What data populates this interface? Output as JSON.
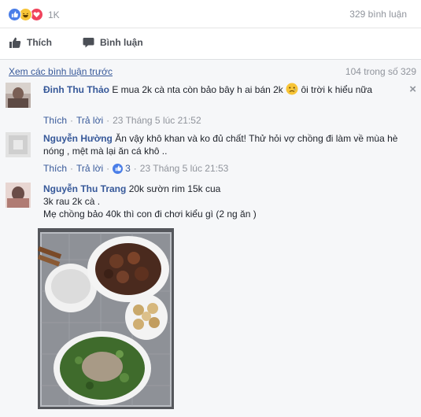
{
  "reactions": {
    "count": "1K",
    "types": [
      "like-icon",
      "haha-icon",
      "love-icon"
    ],
    "colors": {
      "like": "#4a7ee8",
      "haha": "#f7c437",
      "love": "#f0435c"
    }
  },
  "comment_count": "329 bình luận",
  "actions": {
    "like_label": "Thích",
    "comment_label": "Bình luận"
  },
  "comments_header": {
    "view_previous": "Xem các bình luận trước",
    "progress": "104 trong số 329"
  },
  "comments": [
    {
      "author": "Đinh Thu Thảo",
      "text_before_emoji": "E mua 2k cà nta còn bảo bây h ai bán 2k",
      "text_after_emoji": " ôi trời k hiểu nữa",
      "emoji": "sad-face-icon",
      "like_label": "Thích",
      "reply_label": "Trả lời",
      "timestamp": "23 Tháng 5 lúc 21:52",
      "close": "×"
    },
    {
      "author": "Nguyễn Hường",
      "text": "Ăn vậy khô khan và ko đủ chất! Thử hỏi vợ chồng đi làm về mùa hè nóng , mệt mà lại ăn cá khô ..",
      "like_label": "Thích",
      "reply_label": "Trả lời",
      "like_count": "3",
      "timestamp": "23 Tháng 5 lúc 21:53"
    },
    {
      "author": "Nguyễn Thu Trang",
      "line1": "20k sườn rim 15k cua",
      "line2": "3k rau 2k cà .",
      "line3": "Mẹ chồng bảo 40k thì con đi chơi kiểu gì (2 ng ăn )",
      "photo": "meal-photo"
    }
  ],
  "accent_colors": {
    "link": "#365899",
    "meta": "#90949c",
    "background": "#f6f7f9"
  }
}
